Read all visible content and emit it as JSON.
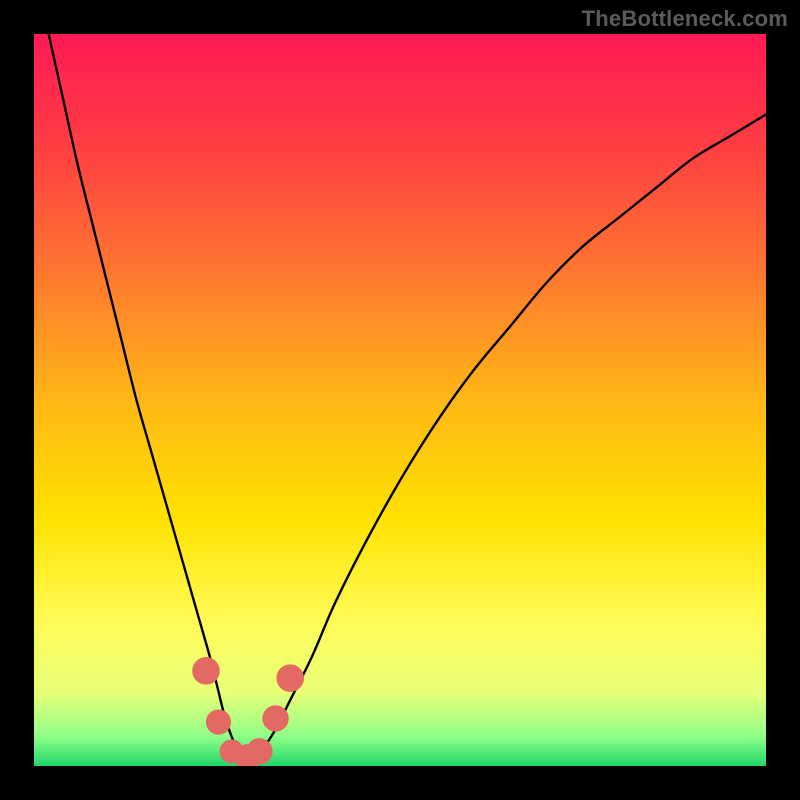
{
  "watermark": "TheBottleneck.com",
  "chart_data": {
    "type": "line",
    "title": "",
    "xlabel": "",
    "ylabel": "",
    "xlim": [
      0,
      100
    ],
    "ylim": [
      0,
      100
    ],
    "legend": false,
    "grid": false,
    "background_gradient": {
      "stops": [
        {
          "offset": 0.0,
          "color": "#ff1a55"
        },
        {
          "offset": 0.14,
          "color": "#ff3a44"
        },
        {
          "offset": 0.3,
          "color": "#ff6e33"
        },
        {
          "offset": 0.5,
          "color": "#ffb716"
        },
        {
          "offset": 0.66,
          "color": "#ffe100"
        },
        {
          "offset": 0.8,
          "color": "#fffb55"
        },
        {
          "offset": 0.9,
          "color": "#e8ff77"
        },
        {
          "offset": 0.96,
          "color": "#8fff88"
        },
        {
          "offset": 1.0,
          "color": "#1fd66b"
        }
      ]
    },
    "series": [
      {
        "name": "bottleneck-curve",
        "x": [
          2,
          4,
          6,
          8,
          10,
          12,
          14,
          16,
          18,
          20,
          22,
          24,
          25,
          26,
          27,
          28,
          29,
          30,
          31,
          33,
          35,
          38,
          41,
          45,
          50,
          55,
          60,
          65,
          70,
          75,
          80,
          85,
          90,
          95,
          100
        ],
        "y": [
          100,
          91,
          82,
          74,
          66,
          58,
          50,
          43,
          36,
          29,
          22,
          15,
          11,
          7,
          4,
          2,
          1,
          1,
          2,
          5,
          9,
          15,
          22,
          30,
          39,
          47,
          54,
          60,
          66,
          71,
          75,
          79,
          83,
          86,
          89
        ]
      }
    ],
    "markers": [
      {
        "x": 23.5,
        "y": 13.0,
        "r": 1.5
      },
      {
        "x": 25.2,
        "y": 6.0,
        "r": 1.3
      },
      {
        "x": 27.0,
        "y": 2.0,
        "r": 1.2
      },
      {
        "x": 29.2,
        "y": 1.2,
        "r": 1.4
      },
      {
        "x": 30.8,
        "y": 2.0,
        "r": 1.4
      },
      {
        "x": 33.0,
        "y": 6.5,
        "r": 1.4
      },
      {
        "x": 35.0,
        "y": 12.0,
        "r": 1.5
      }
    ],
    "marker_color": "#e26a63"
  }
}
